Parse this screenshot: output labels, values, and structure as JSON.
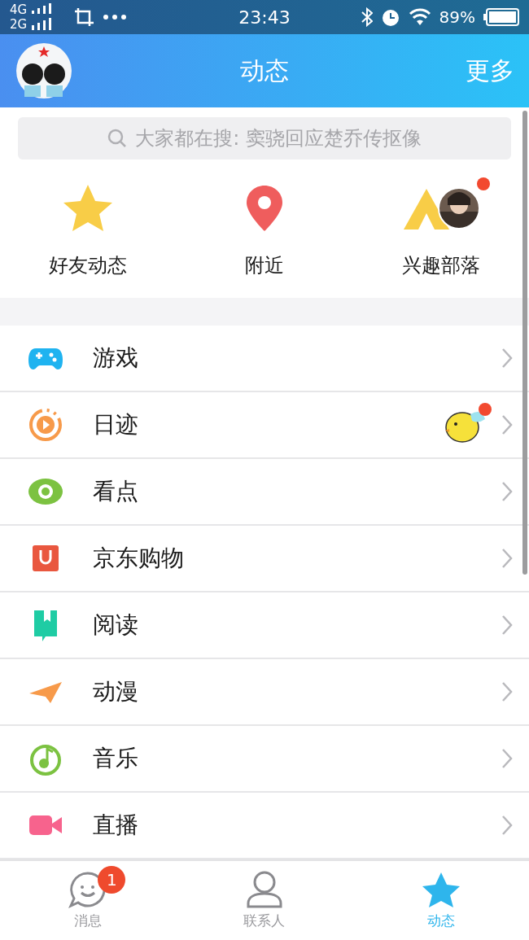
{
  "status_bar": {
    "network_top": "4G",
    "network_bottom": "2G",
    "time": "23:43",
    "battery": "89%"
  },
  "header": {
    "title": "动态",
    "action": "更多"
  },
  "search": {
    "placeholder": "大家都在搜: 窦骁回应楚乔传抠像"
  },
  "shortcuts": [
    {
      "kind": "star",
      "label": "好友动态",
      "new": false
    },
    {
      "kind": "pin",
      "label": "附近",
      "new": false
    },
    {
      "kind": "tent",
      "label": "兴趣部落",
      "new": true
    }
  ],
  "items": [
    {
      "kind": "game",
      "label": "游戏",
      "new": false
    },
    {
      "kind": "play",
      "label": "日迹",
      "new": true
    },
    {
      "kind": "eye",
      "label": "看点",
      "new": false
    },
    {
      "kind": "bag",
      "label": "京东购物",
      "new": false
    },
    {
      "kind": "book",
      "label": "阅读",
      "new": false
    },
    {
      "kind": "plane",
      "label": "动漫",
      "new": false
    },
    {
      "kind": "music",
      "label": "音乐",
      "new": false
    },
    {
      "kind": "camera",
      "label": "直播",
      "new": false
    }
  ],
  "tabs": [
    {
      "kind": "chat",
      "label": "消息",
      "badge": "1",
      "selected": false
    },
    {
      "kind": "person",
      "label": "联系人",
      "selected": false
    },
    {
      "kind": "star",
      "label": "动态",
      "selected": true
    }
  ]
}
